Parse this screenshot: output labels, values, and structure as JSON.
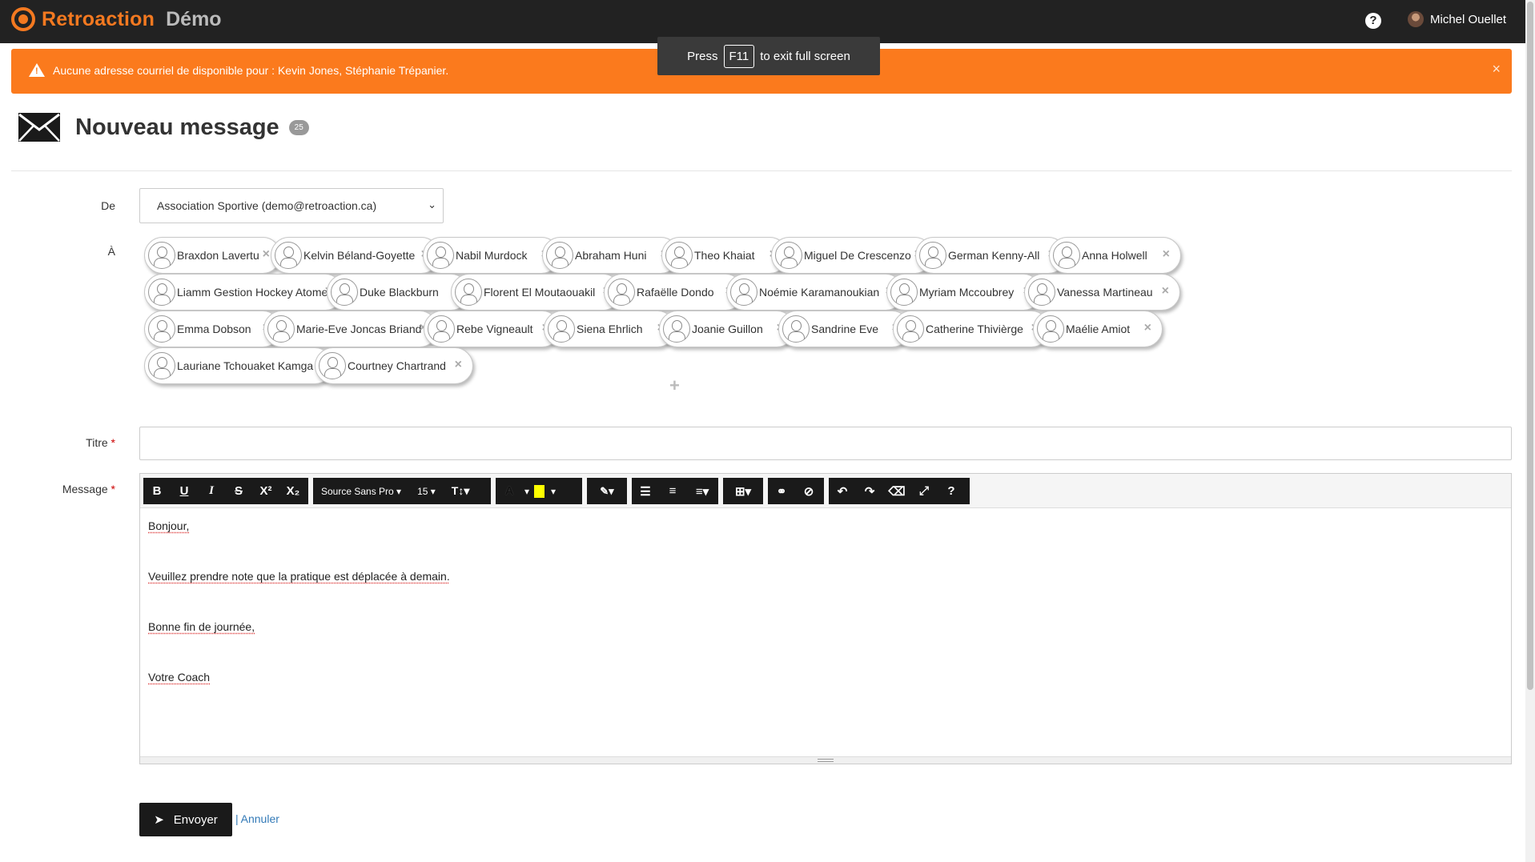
{
  "app": {
    "brand_name": "Retroaction",
    "brand_sub": "Démo",
    "help_icon": "question-circle-icon",
    "user_name": "Michel Ouellet",
    "brand_color": "#f47920"
  },
  "fullscreen_toast": {
    "prefix": "Press",
    "key": "F11",
    "suffix": "to exit full screen"
  },
  "alert": {
    "icon": "warning-icon",
    "text": "Aucune adresse courriel de disponible pour : Kevin Jones, Stéphanie Trépanier.",
    "close": "×",
    "color": "#fb7a1d"
  },
  "page": {
    "title": "Nouveau message",
    "count": "25",
    "icon": "envelope-icon"
  },
  "form": {
    "from_label": "De",
    "from_value": "Association Sportive (demo@retroaction.ca)",
    "to_label": "À",
    "title_label": "Titre",
    "title_value": "",
    "message_label": "Message",
    "required_mark": "*"
  },
  "recipients": [
    "Braxdon Lavertu",
    "Kelvin Béland-Goyette",
    "Nabil Murdock",
    "Abraham Huni",
    "Theo Khaiat",
    "Miguel De Crescenzo",
    "German Kenny-All",
    "Anna Holwell",
    "Liamm Gestion Hockey Atome",
    "Duke Blackburn",
    "Florent El Moutaouakil",
    "Rafaëlle Dondo",
    "Noémie Karamanoukian",
    "Myriam Mccoubrey",
    "Vanessa Martineau",
    "Emma Dobson",
    "Marie-Eve Joncas Briand",
    "Rebe Vigneault",
    "Siena Ehrlich",
    "Joanie Guillon",
    "Sandrine Eve",
    "Catherine Thivièrge",
    "Maélie Amiot",
    "Lauriane Tchouaket Kamga",
    "Courtney Chartrand"
  ],
  "recipient_remove": "×",
  "add_recipient": "+",
  "toolbar": {
    "bold": "B",
    "underline": "U",
    "italic": "I",
    "strike": "S",
    "superscript": "X²",
    "subscript": "X₂",
    "font_family": "Source Sans Pro ▾",
    "font_size": "15 ▾",
    "text_style": "T↕▾",
    "font_color": "A",
    "dropdown": "▾",
    "highlight_color": "#ffff00",
    "magic": "✎▾",
    "ul": "☰",
    "ol": "≡",
    "align": "≡▾",
    "table": "⊞▾",
    "link": "⚭",
    "unlink": "⊘",
    "undo": "↶",
    "redo": "↷",
    "eraser": "⌫",
    "fullscreen": "⤢",
    "help": "?"
  },
  "message_lines": [
    "Bonjour,",
    "Veuillez prendre note que la pratique est déplacée à demain.",
    "Bonne fin de journée,",
    "Votre Coach"
  ],
  "actions": {
    "send": "Envoyer",
    "separator": "|",
    "cancel": "Annuler"
  }
}
